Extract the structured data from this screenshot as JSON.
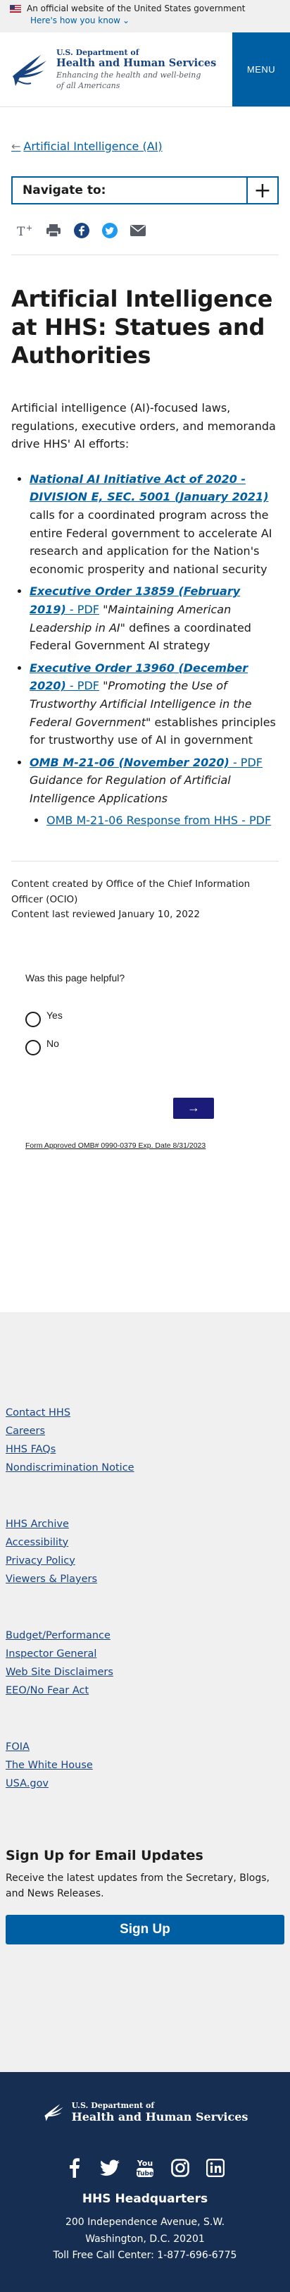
{
  "gov_banner": {
    "official_text": "An official website of the United States government",
    "how_link": "Here's how you know",
    "how_chevron": "⌄"
  },
  "header": {
    "logo_line1": "U.S. Department of",
    "logo_line2": "Health and Human Services",
    "logo_tagline_1": "Enhancing the health and well-being",
    "logo_tagline_2": "of all Americans",
    "menu_label": "MENU"
  },
  "breadcrumb": {
    "back_label": "Artificial Intelligence (AI)"
  },
  "navigate": {
    "label": "Navigate to:"
  },
  "share_icons": [
    "text-size-icon",
    "print-icon",
    "facebook-icon",
    "twitter-icon",
    "email-icon"
  ],
  "page_title": "Artificial Intelligence at HHS: Statues and Authorities",
  "intro": "Artificial intelligence (AI)-focused laws, regulations, executive orders, and memoranda drive HHS' AI efforts:",
  "laws": [
    {
      "link": "National AI Initiative Act of 2020 - DIVISION E, SEC. 5001 (January 2021)",
      "pdf": "",
      "quote": "",
      "text": " calls for a coordinated program across the entire Federal government to accelerate AI research and application for the Nation's economic prosperity and national security"
    },
    {
      "link": "Executive Order 13859 (February 2019)",
      "pdf": " - PDF",
      "quote": "\"Maintaining American Leadership in AI\"",
      "text": " defines a coordinated Federal Government AI strategy"
    },
    {
      "link": "Executive Order 13960 (December 2020)",
      "pdf": " - PDF",
      "quote": "\"Promoting the Use of Trustworthy Artificial Intelligence in the Federal Government\"",
      "text": " establishes principles for trustworthy use of AI in government"
    },
    {
      "link": "OMB M-21-06 (November 2020)",
      "pdf": " - PDF",
      "quote": " Guidance for Regulation of Artificial Intelligence Applications",
      "text": ""
    }
  ],
  "sub_link": "OMB M-21-06 Response from HHS - PDF",
  "meta": {
    "created": "Content created by Office of the Chief Information Officer (OCIO)",
    "reviewed": "Content last reviewed January 10, 2022"
  },
  "feedback": {
    "question": "Was this page helpful?",
    "yes": "Yes",
    "no": "No",
    "submit_arrow": "→",
    "omb_notice": "Form Approved OMB# 0990-0379 Exp. Date 8/31/2023"
  },
  "footer_groups": [
    [
      "Contact HHS",
      "Careers",
      "HHS FAQs",
      "Nondiscrimination Notice"
    ],
    [
      "HHS Archive",
      "Accessibility",
      "Privacy Policy",
      "Viewers & Players"
    ],
    [
      "Budget/Performance",
      "Inspector General",
      "Web Site Disclaimers",
      "EEO/No Fear Act"
    ],
    [
      "FOIA",
      "The White House",
      "USA.gov"
    ]
  ],
  "signup": {
    "title": "Sign Up for Email Updates",
    "description": "Receive the latest updates from the Secretary, Blogs, and News Releases.",
    "button": "Sign Up"
  },
  "footer_dark": {
    "logo_line1": "U.S. Department of",
    "logo_line2": "Health and Human Services",
    "social": [
      "facebook-icon",
      "twitter-icon",
      "youtube-icon",
      "instagram-icon",
      "linkedin-icon"
    ],
    "hq_title": "HHS Headquarters",
    "address_1": "200 Independence Avenue, S.W.",
    "address_2": "Washington, D.C. 20201",
    "phone": "Toll Free Call Center: 1-877-696-6775"
  },
  "colors": {
    "primary": "#005ea2",
    "navy": "#162e51",
    "submit": "#1b1b7a"
  }
}
